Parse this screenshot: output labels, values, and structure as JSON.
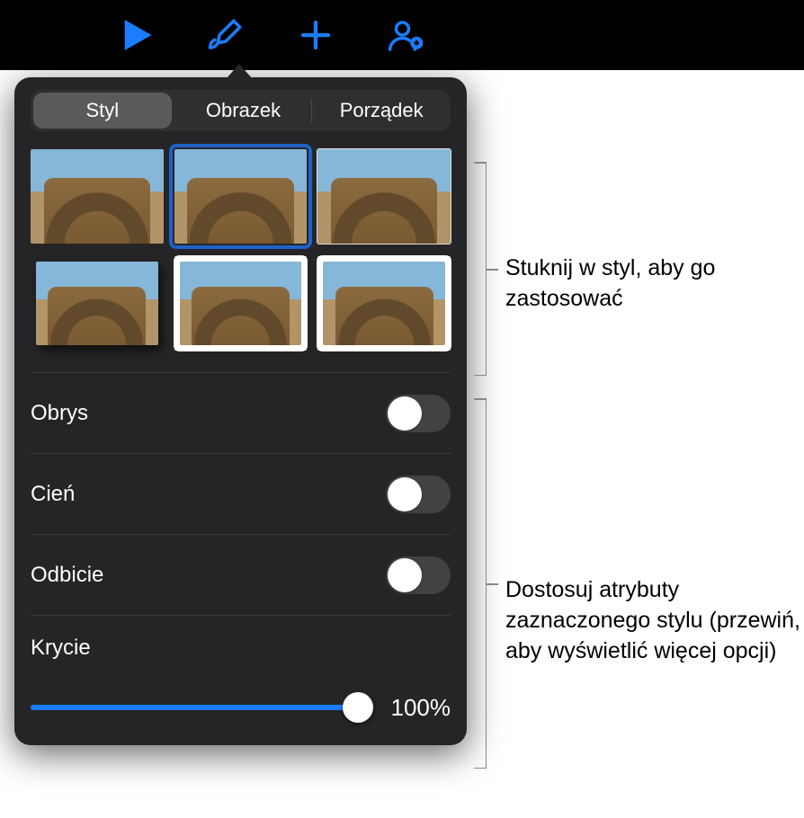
{
  "toolbar": {
    "icons": [
      "play-icon",
      "format-brush-icon",
      "add-icon",
      "collaborate-icon"
    ]
  },
  "popover": {
    "tabs": [
      {
        "label": "Styl",
        "selected": true
      },
      {
        "label": "Obrazek",
        "selected": false
      },
      {
        "label": "Porządek",
        "selected": false
      }
    ],
    "settings": {
      "stroke_label": "Obrys",
      "shadow_label": "Cień",
      "reflection_label": "Odbicie",
      "opacity_label": "Krycie",
      "opacity_value": "100%"
    }
  },
  "callouts": {
    "styles": "Stuknij w styl, aby go zastosować",
    "attributes": "Dostosuj atrybuty zaznaczonego stylu (przewiń, aby wyświetlić więcej opcji)"
  }
}
